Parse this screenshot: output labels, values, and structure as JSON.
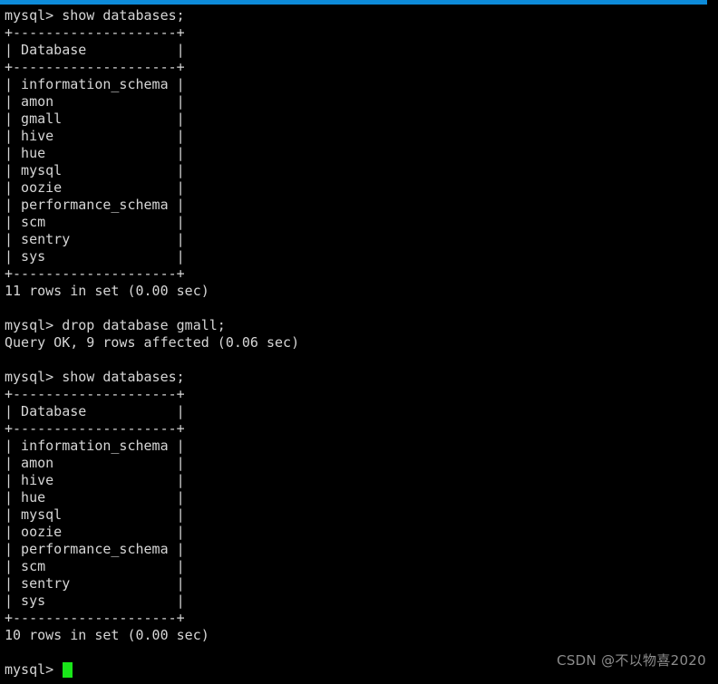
{
  "window": {
    "accent_color": "#0d8bd9",
    "background_color": "#000000",
    "text_color": "#d6d6d6",
    "cursor_color": "#19e619"
  },
  "terminal": {
    "prompt": "mysql> ",
    "lines": [
      {
        "type": "command",
        "text": "mysql> show databases;"
      },
      {
        "type": "rule",
        "text": "+--------------------+"
      },
      {
        "type": "row",
        "text": "| Database           |"
      },
      {
        "type": "rule",
        "text": "+--------------------+"
      },
      {
        "type": "row",
        "text": "| information_schema |"
      },
      {
        "type": "row",
        "text": "| amon               |"
      },
      {
        "type": "row",
        "text": "| gmall              |"
      },
      {
        "type": "row",
        "text": "| hive               |"
      },
      {
        "type": "row",
        "text": "| hue                |"
      },
      {
        "type": "row",
        "text": "| mysql              |"
      },
      {
        "type": "row",
        "text": "| oozie              |"
      },
      {
        "type": "row",
        "text": "| performance_schema |"
      },
      {
        "type": "row",
        "text": "| scm                |"
      },
      {
        "type": "row",
        "text": "| sentry             |"
      },
      {
        "type": "row",
        "text": "| sys                |"
      },
      {
        "type": "rule",
        "text": "+--------------------+"
      },
      {
        "type": "status",
        "text": "11 rows in set (0.00 sec)"
      },
      {
        "type": "blank",
        "text": " "
      },
      {
        "type": "command",
        "text": "mysql> drop database gmall;"
      },
      {
        "type": "status",
        "text": "Query OK, 9 rows affected (0.06 sec)"
      },
      {
        "type": "blank",
        "text": " "
      },
      {
        "type": "command",
        "text": "mysql> show databases;"
      },
      {
        "type": "rule",
        "text": "+--------------------+"
      },
      {
        "type": "row",
        "text": "| Database           |"
      },
      {
        "type": "rule",
        "text": "+--------------------+"
      },
      {
        "type": "row",
        "text": "| information_schema |"
      },
      {
        "type": "row",
        "text": "| amon               |"
      },
      {
        "type": "row",
        "text": "| hive               |"
      },
      {
        "type": "row",
        "text": "| hue                |"
      },
      {
        "type": "row",
        "text": "| mysql              |"
      },
      {
        "type": "row",
        "text": "| oozie              |"
      },
      {
        "type": "row",
        "text": "| performance_schema |"
      },
      {
        "type": "row",
        "text": "| scm                |"
      },
      {
        "type": "row",
        "text": "| sentry             |"
      },
      {
        "type": "row",
        "text": "| sys                |"
      },
      {
        "type": "rule",
        "text": "+--------------------+"
      },
      {
        "type": "status",
        "text": "10 rows in set (0.00 sec)"
      },
      {
        "type": "blank",
        "text": " "
      }
    ],
    "active_prompt": "mysql> "
  },
  "watermark": {
    "text": "CSDN @不以物喜2020"
  }
}
